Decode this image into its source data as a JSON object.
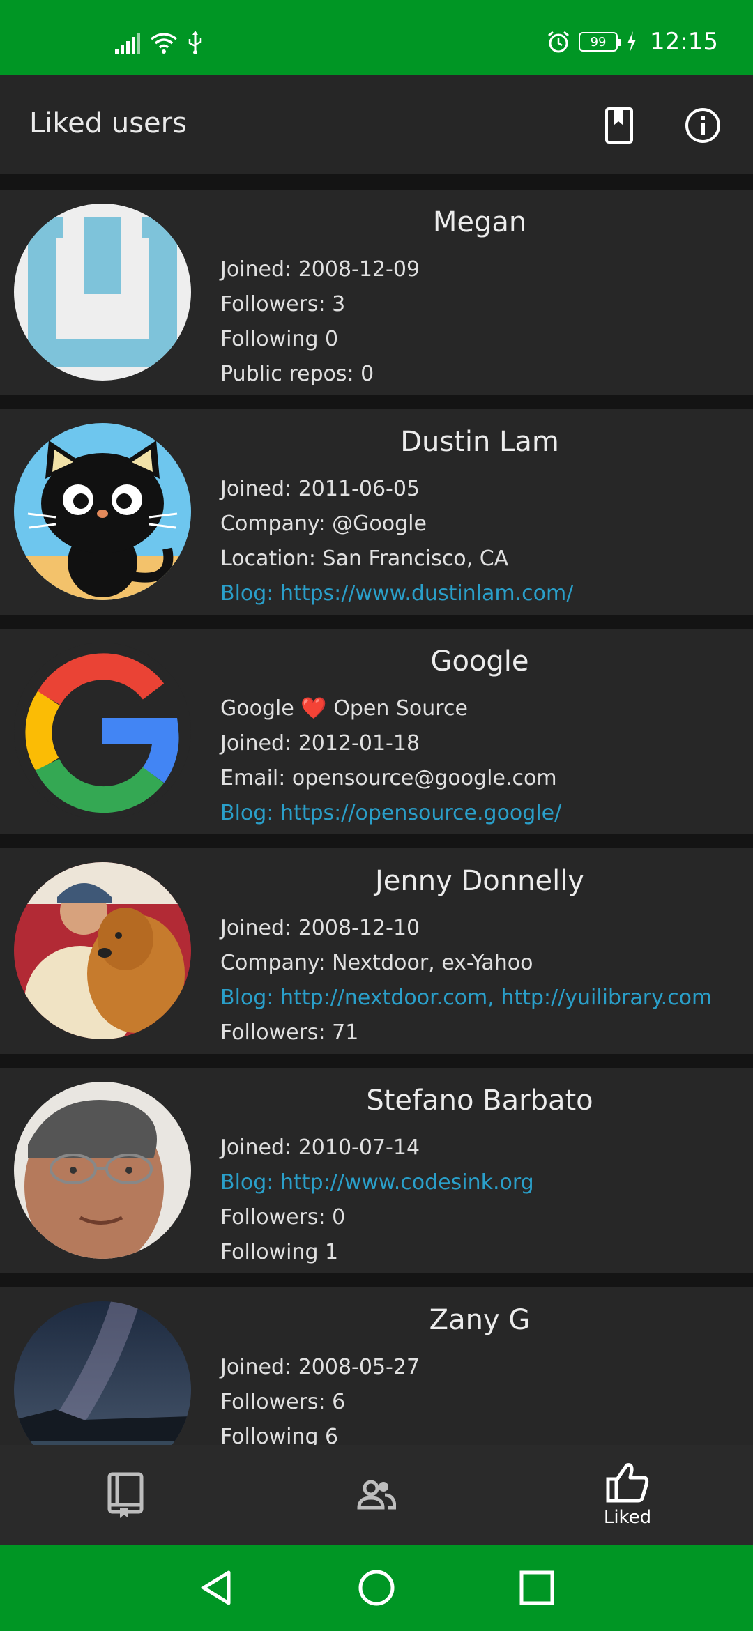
{
  "status_bar": {
    "time": "12:15",
    "battery": "99",
    "icons": [
      "signal-icon",
      "wifi-icon",
      "usb-icon",
      "alarm-icon",
      "battery-icon",
      "charging-icon"
    ]
  },
  "app_bar": {
    "title": "Liked users",
    "actions": [
      "bookmark-icon",
      "info-icon"
    ]
  },
  "users": [
    {
      "name": "Megan",
      "lines": [
        {
          "text": "Joined: 2008-12-09",
          "link": false
        },
        {
          "text": "Followers: 3",
          "link": false
        },
        {
          "text": "Following 0",
          "link": false
        },
        {
          "text": "Public repos: 0",
          "link": false
        }
      ]
    },
    {
      "name": "Dustin Lam",
      "lines": [
        {
          "text": "Joined: 2011-06-05",
          "link": false
        },
        {
          "text": "Company: @Google",
          "link": false
        },
        {
          "text": "Location: San Francisco, CA",
          "link": false
        },
        {
          "text": "Blog: https://www.dustinlam.com/",
          "link": true
        }
      ]
    },
    {
      "name": "Google",
      "lines": [
        {
          "text": "Google ❤️ Open Source",
          "link": false
        },
        {
          "text": "Joined: 2012-01-18",
          "link": false
        },
        {
          "text": "Email: opensource@google.com",
          "link": false
        },
        {
          "text": "Blog: https://opensource.google/",
          "link": true
        }
      ]
    },
    {
      "name": "Jenny Donnelly",
      "lines": [
        {
          "text": "Joined: 2008-12-10",
          "link": false
        },
        {
          "text": "Company: Nextdoor, ex-Yahoo",
          "link": false
        },
        {
          "text": "Blog: http://nextdoor.com, http://yuilibrary.com",
          "link": true
        },
        {
          "text": "Followers: 71",
          "link": false
        }
      ]
    },
    {
      "name": "Stefano Barbato",
      "lines": [
        {
          "text": "Joined: 2010-07-14",
          "link": false
        },
        {
          "text": "Blog: http://www.codesink.org",
          "link": true
        },
        {
          "text": "Followers: 0",
          "link": false
        },
        {
          "text": "Following 1",
          "link": false
        }
      ]
    },
    {
      "name": "Zany G",
      "lines": [
        {
          "text": "Joined: 2008-05-27",
          "link": false
        },
        {
          "text": "Followers: 6",
          "link": false
        },
        {
          "text": "Following 6",
          "link": false
        }
      ]
    }
  ],
  "bottom_nav": {
    "items": [
      {
        "icon": "repo-book-icon",
        "label": ""
      },
      {
        "icon": "people-icon",
        "label": ""
      },
      {
        "icon": "thumb-up-icon",
        "label": "Liked"
      }
    ]
  },
  "system_nav": [
    "back-icon",
    "home-icon",
    "recents-icon"
  ],
  "colors": {
    "status_bar": "#009624",
    "app_bar": "#262626",
    "card": "#272727",
    "link": "#2a9fc9"
  }
}
